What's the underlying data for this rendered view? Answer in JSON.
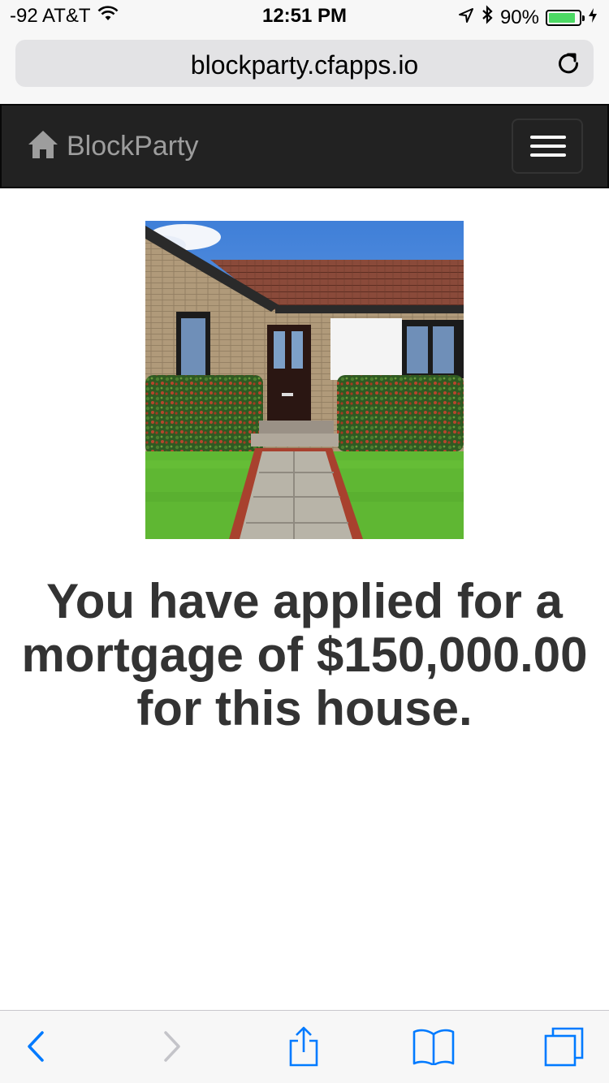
{
  "status_bar": {
    "signal": "-92 AT&T",
    "time": "12:51 PM",
    "battery_percent": "90%",
    "battery_level": 0.9
  },
  "browser": {
    "url": "blockparty.cfapps.io"
  },
  "navbar": {
    "brand": "BlockParty"
  },
  "main": {
    "message": "You have applied for a mortgage of $150,000.00 for this house."
  },
  "colors": {
    "navbar_bg": "#222222",
    "brand_text": "#9d9d9d",
    "ios_blue": "#007aff",
    "battery_green": "#4cd964"
  },
  "icons": [
    "wifi-icon",
    "location-arrow-icon",
    "bluetooth-icon",
    "battery-icon",
    "charging-icon",
    "reload-icon",
    "home-icon",
    "hamburger-icon",
    "back-icon",
    "forward-icon",
    "share-icon",
    "bookmarks-icon",
    "tabs-icon"
  ]
}
